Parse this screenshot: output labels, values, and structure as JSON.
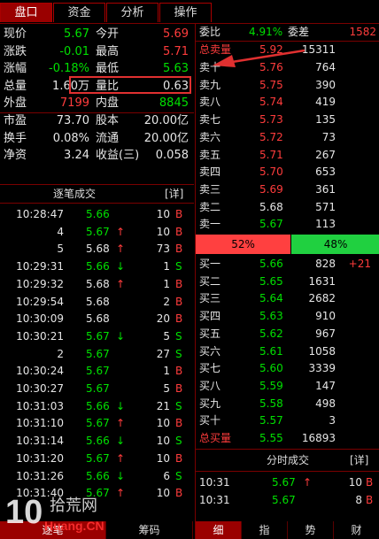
{
  "tabs": [
    "盘口",
    "资金",
    "分析",
    "操作"
  ],
  "stats": [
    {
      "l1": "现价",
      "v1": "5.67",
      "c1": "green",
      "l2": "今开",
      "v2": "5.69",
      "c2": "red"
    },
    {
      "l1": "涨跌",
      "v1": "-0.01",
      "c1": "green",
      "l2": "最高",
      "v2": "5.71",
      "c2": "red"
    },
    {
      "l1": "涨幅",
      "v1": "-0.18%",
      "c1": "green",
      "l2": "最低",
      "v2": "5.63",
      "c2": "green"
    },
    {
      "l1": "总量",
      "v1": "1.60万",
      "c1": "white",
      "l2": "量比",
      "v2": "0.63",
      "c2": "white"
    },
    {
      "l1": "外盘",
      "v1": "7199",
      "c1": "red",
      "l2": "内盘",
      "v2": "8845",
      "c2": "green"
    },
    {
      "l1": "市盈",
      "v1": "73.70",
      "c1": "white",
      "l2": "股本",
      "v2": "20.00亿",
      "c2": "white"
    },
    {
      "l1": "换手",
      "v1": "0.08%",
      "c1": "white",
      "l2": "流通",
      "v2": "20.00亿",
      "c2": "white"
    },
    {
      "l1": "净资",
      "v1": "3.24",
      "c1": "white",
      "l2": "收益(三)",
      "v2": "0.058",
      "c2": "white"
    }
  ],
  "ticks_header": {
    "title": "逐笔成交",
    "detail": "[详]"
  },
  "ticks": [
    {
      "time": "10:28:47",
      "price": "5.66",
      "pc": "green",
      "arrow": "",
      "ac": "",
      "vol": "10",
      "bs": "B",
      "bsc": "red"
    },
    {
      "time": "4",
      "price": "5.67",
      "pc": "green",
      "arrow": "↑",
      "ac": "red",
      "vol": "10",
      "bs": "B",
      "bsc": "red"
    },
    {
      "time": "5",
      "price": "5.68",
      "pc": "white",
      "arrow": "↑",
      "ac": "red",
      "vol": "73",
      "bs": "B",
      "bsc": "red"
    },
    {
      "time": "10:29:31",
      "price": "5.66",
      "pc": "green",
      "arrow": "↓",
      "ac": "green",
      "vol": "1",
      "bs": "S",
      "bsc": "green"
    },
    {
      "time": "10:29:32",
      "price": "5.68",
      "pc": "white",
      "arrow": "↑",
      "ac": "red",
      "vol": "1",
      "bs": "B",
      "bsc": "red"
    },
    {
      "time": "10:29:54",
      "price": "5.68",
      "pc": "white",
      "arrow": "",
      "ac": "",
      "vol": "2",
      "bs": "B",
      "bsc": "red"
    },
    {
      "time": "10:30:09",
      "price": "5.68",
      "pc": "white",
      "arrow": "",
      "ac": "",
      "vol": "20",
      "bs": "B",
      "bsc": "red"
    },
    {
      "time": "10:30:21",
      "price": "5.67",
      "pc": "green",
      "arrow": "↓",
      "ac": "green",
      "vol": "5",
      "bs": "S",
      "bsc": "green"
    },
    {
      "time": "2",
      "price": "5.67",
      "pc": "green",
      "arrow": "",
      "ac": "",
      "vol": "27",
      "bs": "S",
      "bsc": "green"
    },
    {
      "time": "10:30:24",
      "price": "5.67",
      "pc": "green",
      "arrow": "",
      "ac": "",
      "vol": "1",
      "bs": "B",
      "bsc": "red"
    },
    {
      "time": "10:30:27",
      "price": "5.67",
      "pc": "green",
      "arrow": "",
      "ac": "",
      "vol": "5",
      "bs": "B",
      "bsc": "red"
    },
    {
      "time": "10:31:03",
      "price": "5.66",
      "pc": "green",
      "arrow": "↓",
      "ac": "green",
      "vol": "21",
      "bs": "S",
      "bsc": "green"
    },
    {
      "time": "10:31:10",
      "price": "5.67",
      "pc": "green",
      "arrow": "↑",
      "ac": "red",
      "vol": "10",
      "bs": "B",
      "bsc": "red"
    },
    {
      "time": "10:31:14",
      "price": "5.66",
      "pc": "green",
      "arrow": "↓",
      "ac": "green",
      "vol": "10",
      "bs": "S",
      "bsc": "green"
    },
    {
      "time": "10:31:20",
      "price": "5.67",
      "pc": "green",
      "arrow": "↑",
      "ac": "red",
      "vol": "10",
      "bs": "B",
      "bsc": "red"
    },
    {
      "time": "10:31:26",
      "price": "5.66",
      "pc": "green",
      "arrow": "↓",
      "ac": "green",
      "vol": "6",
      "bs": "S",
      "bsc": "green"
    },
    {
      "time": "10:31:40",
      "price": "5.67",
      "pc": "green",
      "arrow": "↑",
      "ac": "red",
      "vol": "10",
      "bs": "B",
      "bsc": "red"
    }
  ],
  "left_bottom_tabs": [
    "逐笔",
    "筹码"
  ],
  "weibi": {
    "label1": "委比",
    "value1": "4.91%",
    "label2": "委差",
    "value2": "1582"
  },
  "total_sell": {
    "label": "总卖量",
    "price": "5.92",
    "vol": "15311"
  },
  "asks": [
    {
      "label": "卖十",
      "price": "5.76",
      "pc": "red",
      "vol": "764"
    },
    {
      "label": "卖九",
      "price": "5.75",
      "pc": "red",
      "vol": "390"
    },
    {
      "label": "卖八",
      "price": "5.74",
      "pc": "red",
      "vol": "419"
    },
    {
      "label": "卖七",
      "price": "5.73",
      "pc": "red",
      "vol": "135"
    },
    {
      "label": "卖六",
      "price": "5.72",
      "pc": "red",
      "vol": "73"
    },
    {
      "label": "卖五",
      "price": "5.71",
      "pc": "red",
      "vol": "267"
    },
    {
      "label": "卖四",
      "price": "5.70",
      "pc": "red",
      "vol": "653"
    },
    {
      "label": "卖三",
      "price": "5.69",
      "pc": "red",
      "vol": "361"
    },
    {
      "label": "卖二",
      "price": "5.68",
      "pc": "white",
      "vol": "571"
    },
    {
      "label": "卖一",
      "price": "5.67",
      "pc": "green",
      "vol": "113"
    }
  ],
  "ratio": {
    "sell": "52%",
    "buy": "48%",
    "sell_fraction": 0.52,
    "sell_color": "#ff4040",
    "buy_color": "#20d040"
  },
  "bids": [
    {
      "label": "买一",
      "price": "5.66",
      "pc": "green",
      "vol": "828",
      "chg": "+21"
    },
    {
      "label": "买二",
      "price": "5.65",
      "pc": "green",
      "vol": "1631",
      "chg": ""
    },
    {
      "label": "买三",
      "price": "5.64",
      "pc": "green",
      "vol": "2682",
      "chg": ""
    },
    {
      "label": "买四",
      "price": "5.63",
      "pc": "green",
      "vol": "910",
      "chg": ""
    },
    {
      "label": "买五",
      "price": "5.62",
      "pc": "green",
      "vol": "967",
      "chg": ""
    },
    {
      "label": "买六",
      "price": "5.61",
      "pc": "green",
      "vol": "1058",
      "chg": ""
    },
    {
      "label": "买七",
      "price": "5.60",
      "pc": "green",
      "vol": "3339",
      "chg": ""
    },
    {
      "label": "买八",
      "price": "5.59",
      "pc": "green",
      "vol": "147",
      "chg": ""
    },
    {
      "label": "买九",
      "price": "5.58",
      "pc": "green",
      "vol": "498",
      "chg": ""
    },
    {
      "label": "买十",
      "price": "5.57",
      "pc": "green",
      "vol": "3",
      "chg": ""
    }
  ],
  "total_buy": {
    "label": "总买量",
    "price": "5.55",
    "vol": "16893"
  },
  "fenshi_header": {
    "title": "分时成交",
    "detail": "[详]"
  },
  "fenshi": [
    {
      "time": "10:31",
      "price": "5.67",
      "arrow": "↑",
      "vol": "10",
      "bs": "B"
    },
    {
      "time": "10:31",
      "price": "5.67",
      "arrow": "",
      "vol": "8",
      "bs": "B"
    }
  ],
  "right_bottom_tabs": [
    "细",
    "指",
    "势",
    "财"
  ],
  "watermark": {
    "num": "10",
    "brand": "拾荒网",
    "url": "Huang.CN"
  }
}
